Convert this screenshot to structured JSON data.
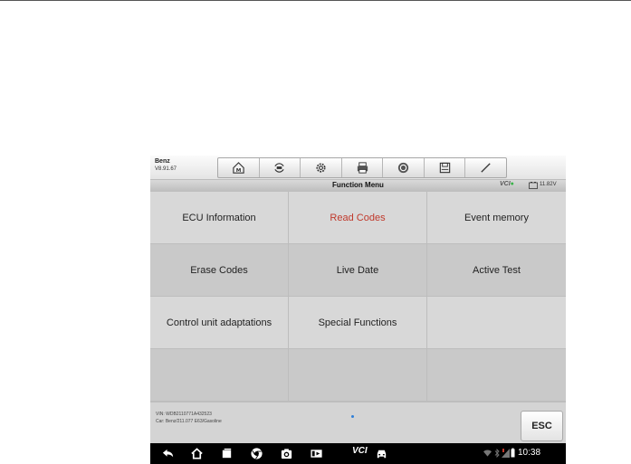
{
  "header": {
    "vehicle": "Benz",
    "version": "V8.91.67",
    "toolbar_icons": [
      "home-icon",
      "vehicle-swap-icon",
      "settings-icon",
      "print-icon",
      "help-icon",
      "save-icon",
      "edit-icon"
    ]
  },
  "titlebar": {
    "title": "Function Menu",
    "vci": "VCI",
    "voltage": "11.82V"
  },
  "menu": [
    {
      "label": "ECU Information",
      "selected": false
    },
    {
      "label": "Read Codes",
      "selected": true
    },
    {
      "label": "Event memory",
      "selected": false
    },
    {
      "label": "Erase Codes",
      "selected": false
    },
    {
      "label": "Live Date",
      "selected": false
    },
    {
      "label": "Active Test",
      "selected": false
    },
    {
      "label": "Control unit adaptations",
      "selected": false
    },
    {
      "label": "Special Functions",
      "selected": false
    },
    {
      "label": "",
      "selected": false
    },
    {
      "label": "",
      "selected": false
    },
    {
      "label": "",
      "selected": false
    },
    {
      "label": "",
      "selected": false
    }
  ],
  "footer": {
    "vin": "VIN: WDB2110771A432523",
    "car": "Car: Benz/211.077 E63/Gasoline",
    "esc_label": "ESC"
  },
  "navbar": {
    "vci_label": "VCI",
    "time": "10:38",
    "icons": [
      "back-icon",
      "home-icon",
      "recent-apps-icon",
      "chrome-icon",
      "camera-icon",
      "screen-record-icon",
      "vci-icon",
      "car-icon"
    ]
  },
  "colors": {
    "selected_text": "#c0392b",
    "accent_blue": "#2f7fd8",
    "vci_green": "#3bb34a"
  }
}
